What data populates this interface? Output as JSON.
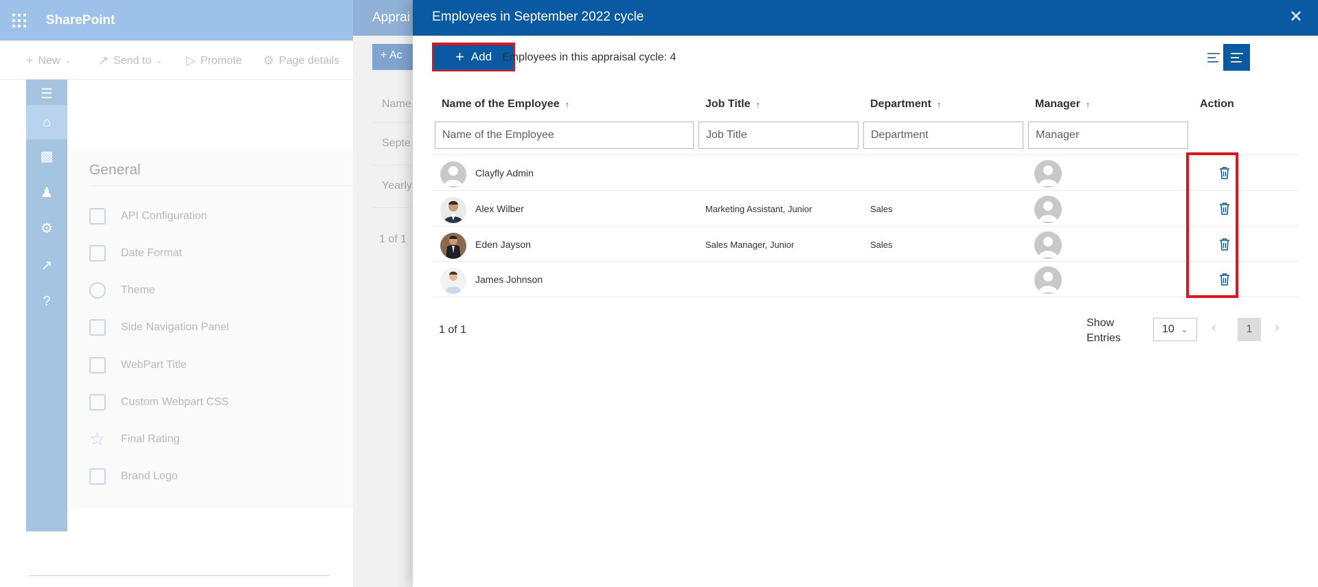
{
  "app": {
    "brand": "SharePoint"
  },
  "commandbar": {
    "new": "New",
    "send_to": "Send to",
    "promote": "Promote",
    "page_details": "Page details"
  },
  "settings": {
    "title": "General",
    "items": [
      {
        "label": "API Configuration",
        "icon": "api-config-icon"
      },
      {
        "label": "Date Format",
        "icon": "calendar-icon"
      },
      {
        "label": "Theme",
        "icon": "palette-icon"
      },
      {
        "label": "Side Navigation Panel",
        "icon": "side-panel-icon"
      },
      {
        "label": "WebPart Title",
        "icon": "webpart-title-icon"
      },
      {
        "label": "Custom Webpart CSS",
        "icon": "edit-css-icon"
      },
      {
        "label": "Final Rating",
        "icon": "star-icon"
      },
      {
        "label": "Brand Logo",
        "icon": "briefcase-icon"
      }
    ]
  },
  "back_panel": {
    "title": "Apprai",
    "add": "Ac",
    "rows": [
      "Name",
      "Septe",
      "Yearly"
    ],
    "pager": "1 of 1"
  },
  "modal": {
    "title": "Employees in September 2022 cycle",
    "add_label": "Add",
    "count_text": "Employees in this appraisal cycle: 4",
    "columns": {
      "name": "Name of the Employee",
      "job": "Job Title",
      "dept": "Department",
      "manager": "Manager",
      "action": "Action"
    },
    "filters": {
      "name": "Name of the Employee",
      "job": "Job Title",
      "dept": "Department",
      "manager": "Manager"
    },
    "rows": [
      {
        "name": "Clayfly Admin",
        "job": "",
        "dept": ""
      },
      {
        "name": "Alex Wilber",
        "job": "Marketing Assistant, Junior",
        "dept": "Sales"
      },
      {
        "name": "Eden Jayson",
        "job": "Sales Manager, Junior",
        "dept": "Sales"
      },
      {
        "name": "James Johnson",
        "job": "",
        "dept": ""
      }
    ],
    "pager": {
      "count": "1 of 1",
      "show_entries": "Show Entries",
      "entries_value": "10",
      "page": "1"
    }
  },
  "colors": {
    "accent": "#0a5aa3",
    "highlight": "#e8101a"
  }
}
